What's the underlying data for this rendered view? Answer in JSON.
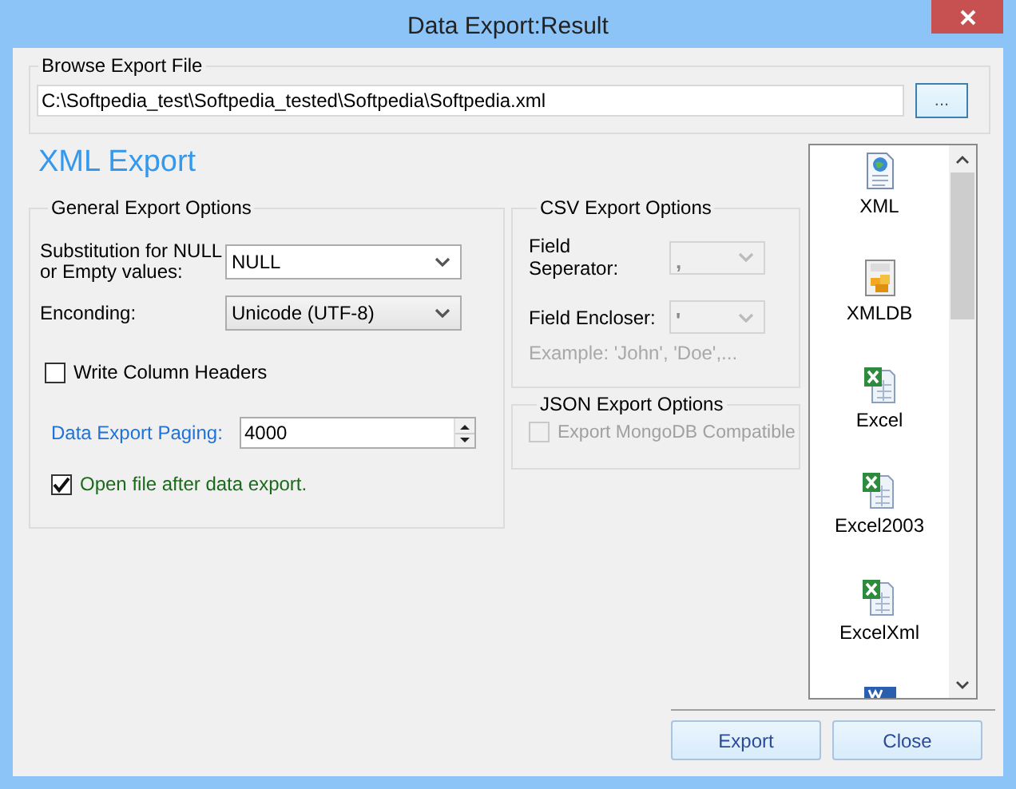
{
  "window": {
    "title": "Data Export:Result"
  },
  "browse": {
    "legend": "Browse Export File",
    "path": "C:\\Softpedia_test\\Softpedia_tested\\Softpedia\\Softpedia.xml",
    "button": "..."
  },
  "heading": "XML Export",
  "general": {
    "legend": "General Export Options",
    "fields": [
      {
        "kind": "select",
        "label": "Substitution for NULL or Empty values:",
        "value": "NULL",
        "color": "#000000"
      },
      {
        "kind": "select",
        "label": "Enconding:",
        "value": "Unicode (UTF-8)",
        "color": "#000000"
      },
      {
        "kind": "checkbox",
        "label": "Write Column Headers",
        "checked": false,
        "color": "#000000"
      },
      {
        "kind": "spin",
        "label": "Data Export Paging:",
        "value": "4000",
        "color": "#1e72d8"
      },
      {
        "kind": "checkbox",
        "label": "Open file after data export.",
        "checked": true,
        "color": "#1a6a1a"
      }
    ]
  },
  "csv": {
    "legend": "CSV Export Options",
    "disabled": true,
    "fields": [
      {
        "label": "Field Seperator:",
        "value": ","
      },
      {
        "label": "Field Encloser:",
        "value": "'"
      }
    ],
    "example": "Example: 'John', 'Doe',..."
  },
  "json": {
    "legend": "JSON Export Options",
    "option": {
      "label": "Export MongoDB Compatible",
      "checked": false,
      "disabled": true
    }
  },
  "formats": [
    {
      "kind": "xml",
      "label": "XML"
    },
    {
      "kind": "xmldb",
      "label": "XMLDB"
    },
    {
      "kind": "excel",
      "label": "Excel"
    },
    {
      "kind": "excel",
      "label": "Excel2003"
    },
    {
      "kind": "excel",
      "label": "ExcelXml"
    },
    {
      "kind": "word"
    }
  ],
  "buttons": [
    "Export",
    "Close"
  ]
}
